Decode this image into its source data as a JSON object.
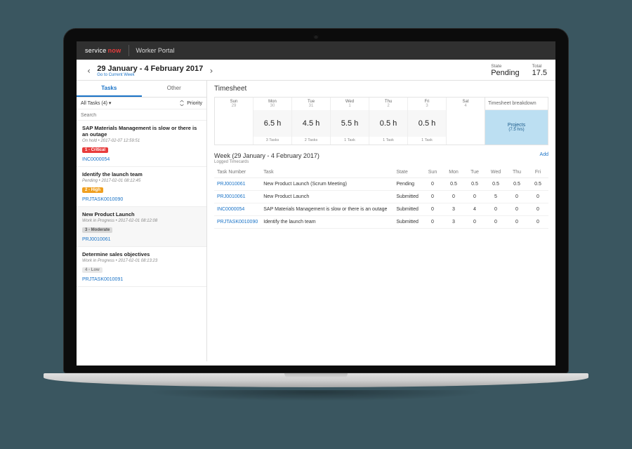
{
  "brand": {
    "part1": "service",
    "part2": "now",
    "portal": "Worker Portal"
  },
  "dateBar": {
    "range": "29 January - 4 February 2017",
    "currentWeek": "Go to Current Week",
    "stateLabel": "State",
    "stateValue": "Pending",
    "totalLabel": "Total",
    "totalValue": "17.5"
  },
  "tabs": {
    "tasks": "Tasks",
    "other": "Other"
  },
  "filters": {
    "all": "All Tasks (4) ▾",
    "priority": "Priority"
  },
  "search": {
    "placeholder": "Search"
  },
  "tasksList": [
    {
      "title": "SAP Materials Management is slow or there is an outage",
      "meta": "On hold • 2017-02-07 12:59:51",
      "badgeClass": "b-critical",
      "badgeText": "1 - Critical",
      "link": "INC0000054"
    },
    {
      "title": "Identify the launch team",
      "meta": "Pending • 2017-02-01 08:12:45",
      "badgeClass": "b-high",
      "badgeText": "2 - High",
      "link": "PRJTASK0010090"
    },
    {
      "title": "New Product Launch",
      "meta": "Work in Progress • 2017-02-01 08:12:08",
      "badgeClass": "b-moderate",
      "badgeText": "3 - Moderate",
      "link": "PRJ0010061"
    },
    {
      "title": "Determine sales objectives",
      "meta": "Work in Progress • 2017-02-01 08:13:23",
      "badgeClass": "b-low",
      "badgeText": "4 - Low",
      "link": "PRJTASK0010091"
    }
  ],
  "timesheet": {
    "heading": "Timesheet",
    "breakdownLabel": "Timesheet breakdown",
    "projectsLabel": "Projects",
    "projectsHours": "(7.5 hrs)",
    "days": [
      {
        "dow": "Sun",
        "num": "29",
        "hours": "",
        "tasks": ""
      },
      {
        "dow": "Mon",
        "num": "30",
        "hours": "6.5 h",
        "tasks": "3 Tasks"
      },
      {
        "dow": "Tue",
        "num": "31",
        "hours": "4.5 h",
        "tasks": "2 Tasks"
      },
      {
        "dow": "Wed",
        "num": "1",
        "hours": "5.5 h",
        "tasks": "1 Task"
      },
      {
        "dow": "Thu",
        "num": "2",
        "hours": "0.5 h",
        "tasks": "1 Task"
      },
      {
        "dow": "Fri",
        "num": "3",
        "hours": "0.5 h",
        "tasks": "1 Task"
      },
      {
        "dow": "Sat",
        "num": "4",
        "hours": "",
        "tasks": ""
      }
    ],
    "weekTitle": "Week (29 January - 4 February 2017)",
    "loggedLabel": "Logged Timecards",
    "addLabel": "Add",
    "cols": {
      "num": "Task Number",
      "task": "Task",
      "state": "State",
      "sun": "Sun",
      "mon": "Mon",
      "tue": "Tue",
      "wed": "Wed",
      "thu": "Thu",
      "fri": "Fri"
    },
    "rows": [
      {
        "num": "PRJ0010061",
        "task": "New Product Launch (Scrum Meeting)",
        "state": "Pending",
        "sun": "0",
        "mon": "0.5",
        "tue": "0.5",
        "wed": "0.5",
        "thu": "0.5",
        "fri": "0.5"
      },
      {
        "num": "PRJ0010061",
        "task": "New Product Launch",
        "state": "Submitted",
        "sun": "0",
        "mon": "0",
        "tue": "0",
        "wed": "5",
        "thu": "0",
        "fri": "0"
      },
      {
        "num": "INC0000054",
        "task": "SAP Materials Management is slow or there is an outage",
        "state": "Submitted",
        "sun": "0",
        "mon": "3",
        "tue": "4",
        "wed": "0",
        "thu": "0",
        "fri": "0"
      },
      {
        "num": "PRJTASK0010090",
        "task": "Identify the launch team",
        "state": "Submitted",
        "sun": "0",
        "mon": "3",
        "tue": "0",
        "wed": "0",
        "thu": "0",
        "fri": "0"
      }
    ]
  }
}
